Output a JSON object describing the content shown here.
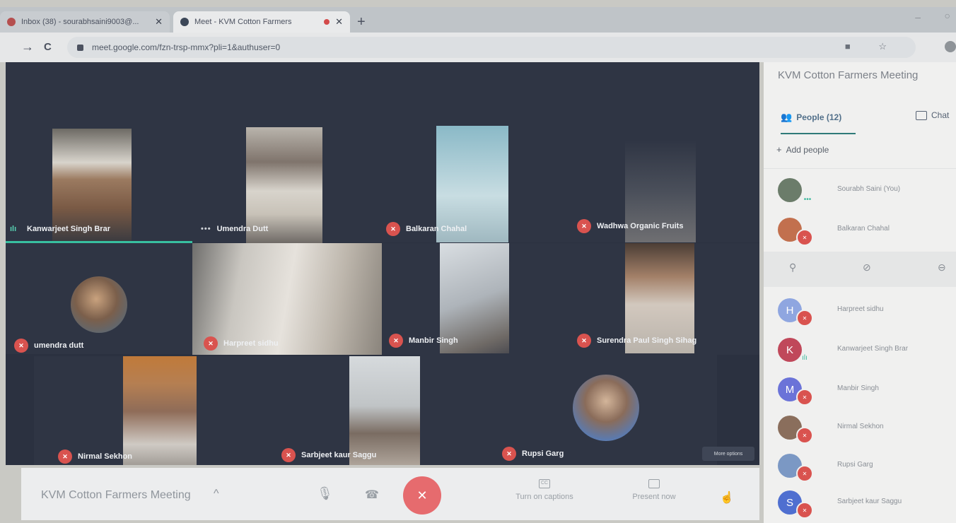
{
  "browser": {
    "tabs": [
      {
        "title": "Inbox (38) - sourabhsaini9003@...",
        "close": "✕",
        "icon_color": "#b54f4f"
      },
      {
        "title": "Meet - KVM Cotton Farmers",
        "close": "✕",
        "icon_color": "#3c4758"
      }
    ],
    "new_tab": "+",
    "url": "meet.google.com/fzn-trsp-mmx?pli=1&authuser=0",
    "back": "←",
    "forward": "→",
    "reload": "C",
    "omnibox_icons": "■ ☆"
  },
  "grid": {
    "tiles": [
      {
        "name": "Kanwarjeet Singh Brar",
        "mic": "on"
      },
      {
        "name": "Umendra Dutt",
        "mic": "dots"
      },
      {
        "name": "Balkaran Chahal",
        "mic": "off"
      },
      {
        "name": "Wadhwa Organic Fruits",
        "mic": "off"
      },
      {
        "name": "umendra dutt",
        "mic": "off"
      },
      {
        "name": "Harpreet sidhu",
        "mic": "off"
      },
      {
        "name": "Manbir Singh",
        "mic": "off"
      },
      {
        "name": "Surendra Paul Singh Sihag",
        "mic": "off"
      },
      {
        "name": "Nirmal Sekhon",
        "mic": "off"
      },
      {
        "name": "Sarbjeet kaur Saggu",
        "mic": "off"
      },
      {
        "name": "Rupsi Garg",
        "mic": "off"
      }
    ],
    "more_options": "More options"
  },
  "toolbar": {
    "meeting_title": "KVM Cotton Farmers Meeting",
    "chevron": "^",
    "captions_label": "Turn on captions",
    "captions_icon_text": "CC",
    "present_label": "Present now"
  },
  "panel": {
    "title": "KVM Cotton Farmers Meeting",
    "people_tab": "People (12)",
    "chat_tab": "Chat",
    "add_people": "Add people",
    "people": [
      {
        "name": "Sourabh Saini (You)",
        "initial": "",
        "color": "#6b7c6a",
        "status": "dots"
      },
      {
        "name": "Balkaran Chahal",
        "initial": "",
        "color": "#c2704e",
        "status": "off"
      },
      {
        "name": "Harpreet sidhu",
        "initial": "H",
        "color": "#8fa6e0",
        "status": "off"
      },
      {
        "name": "Kanwarjeet Singh Brar",
        "initial": "K",
        "color": "#c0485a",
        "status": "on"
      },
      {
        "name": "Manbir Singh",
        "initial": "M",
        "color": "#6b73d8",
        "status": "off"
      },
      {
        "name": "Nirmal Sekhon",
        "initial": "",
        "color": "#8a6e5c",
        "status": "off"
      },
      {
        "name": "Rupsi Garg",
        "initial": "",
        "color": "#7b98c4",
        "status": "off"
      },
      {
        "name": "Sarbjeet kaur Saggu",
        "initial": "S",
        "color": "#4f6fd0",
        "status": "off"
      }
    ]
  }
}
